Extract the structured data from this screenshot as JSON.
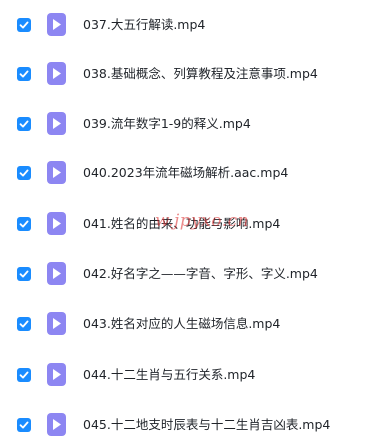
{
  "files": [
    {
      "name": "037.大五行解读.mp4",
      "checked": true,
      "icon": "video-file-icon"
    },
    {
      "name": "038.基础概念、列算教程及注意事项.mp4",
      "checked": true,
      "icon": "video-file-icon"
    },
    {
      "name": "039.流年数字1-9的释义.mp4",
      "checked": true,
      "icon": "video-file-icon"
    },
    {
      "name": "040.2023年流年磁场解析.aac.mp4",
      "checked": true,
      "icon": "video-file-icon"
    },
    {
      "name": "041.姓名的由来、功能与影响.mp4",
      "checked": true,
      "icon": "video-file-icon"
    },
    {
      "name": "042.好名字之——字音、字形、字义.mp4",
      "checked": true,
      "icon": "video-file-icon"
    },
    {
      "name": "043.姓名对应的人生磁场信息.mp4",
      "checked": true,
      "icon": "video-file-icon"
    },
    {
      "name": "044.十二生肖与五行关系.mp4",
      "checked": true,
      "icon": "video-file-icon"
    },
    {
      "name": "045.十二地支时辰表与十二生肖吉凶表.mp4",
      "checked": true,
      "icon": "video-file-icon"
    }
  ],
  "watermark": "w.jpyxo.cn",
  "colors": {
    "checkbox": "#1a8cff",
    "file_icon": "#8d86f2",
    "text": "#1f2329"
  }
}
